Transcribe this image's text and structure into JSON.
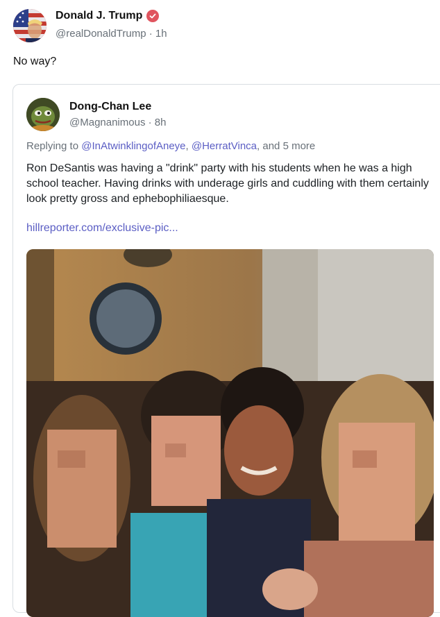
{
  "post": {
    "author_name": "Donald J. Trump",
    "handle": "@realDonaldTrump",
    "time": "1h",
    "text": "No way?",
    "verified_icon": "verified-badge-icon"
  },
  "quoted_post": {
    "author_name": "Dong-Chan Lee",
    "handle": "@Magnanimous",
    "time": "8h",
    "reply_prefix": "Replying to",
    "reply_mention_1": "@InAtwinklingofAneye",
    "reply_mention_2": "@HerratVinca",
    "reply_suffix": "and 5 more",
    "text": "Ron DeSantis was having a \"drink\" party with his students when he was a high school teacher. Having drinks with underage girls and cuddling with them certainly look pretty gross and ephebophiliaesque.",
    "link": "hillreporter.com/exclusive-pic...",
    "image": "photo-of-group"
  },
  "colors": {
    "accent": "#5b5ec4",
    "muted": "#687078",
    "badge": "#e0555f",
    "border": "#d8dde1"
  }
}
